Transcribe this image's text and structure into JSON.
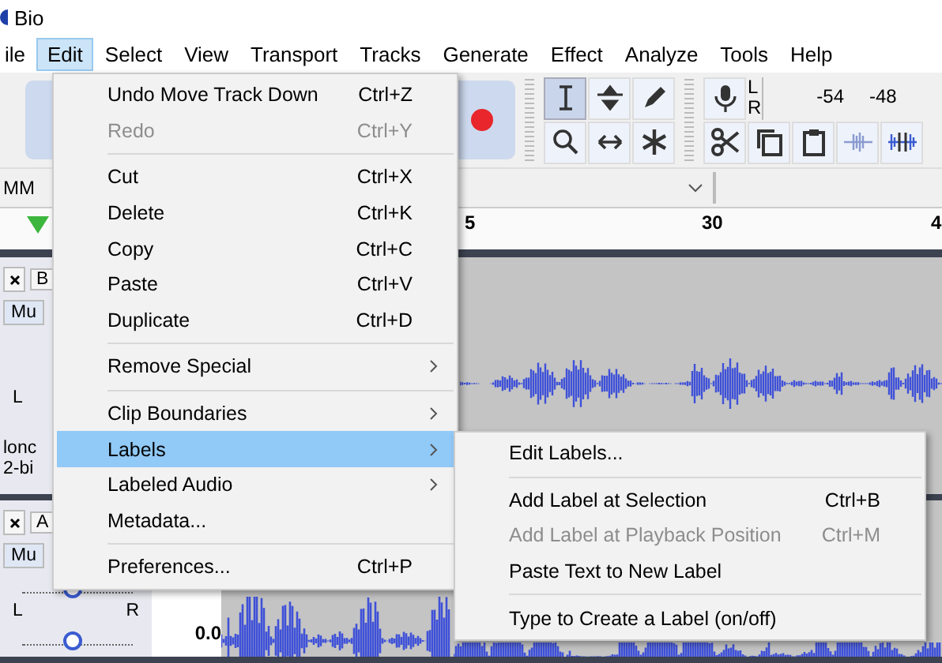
{
  "window": {
    "title": "Bio"
  },
  "menu_bar": [
    {
      "label": "ile",
      "selected": false
    },
    {
      "label": "Edit",
      "selected": true
    },
    {
      "label": "Select",
      "selected": false
    },
    {
      "label": "View",
      "selected": false
    },
    {
      "label": "Transport",
      "selected": false
    },
    {
      "label": "Tracks",
      "selected": false
    },
    {
      "label": "Generate",
      "selected": false
    },
    {
      "label": "Effect",
      "selected": false
    },
    {
      "label": "Analyze",
      "selected": false
    },
    {
      "label": "Tools",
      "selected": false
    },
    {
      "label": "Help",
      "selected": false
    }
  ],
  "tools": [
    {
      "kind": "ibeam",
      "selected": true
    },
    {
      "kind": "envelope",
      "selected": false
    },
    {
      "kind": "draw",
      "selected": false
    },
    {
      "kind": "zoom",
      "selected": false
    },
    {
      "kind": "timeshift",
      "selected": false
    },
    {
      "kind": "multi",
      "selected": false
    }
  ],
  "meter": {
    "channels": [
      "L",
      "R"
    ],
    "ticks": [
      "-54",
      "-48"
    ]
  },
  "device_bar": {
    "device": "MM"
  },
  "ruler": {
    "ticks": [
      "5",
      "30",
      "4"
    ]
  },
  "tracks": [
    {
      "name": "B",
      "mute": "Mu",
      "pan_labels": [
        "L"
      ],
      "info": [
        "lonc",
        "2-bi"
      ]
    },
    {
      "name": "A",
      "mute": "Mu",
      "gain": {
        "level": 0.45
      },
      "pan": {
        "level": 0.45
      },
      "pan_labels": [
        "L",
        "R"
      ],
      "scale": "0.0"
    }
  ],
  "edit_menu": {
    "items": [
      {
        "kind": "item",
        "label": "Undo Move Track Down",
        "shortcut": "Ctrl+Z",
        "disabled": false,
        "submenu": false,
        "selected": false
      },
      {
        "kind": "item",
        "label": "Redo",
        "shortcut": "Ctrl+Y",
        "disabled": true,
        "submenu": false,
        "selected": false
      },
      {
        "kind": "separator"
      },
      {
        "kind": "item",
        "label": "Cut",
        "shortcut": "Ctrl+X",
        "disabled": false,
        "submenu": false,
        "selected": false
      },
      {
        "kind": "item",
        "label": "Delete",
        "shortcut": "Ctrl+K",
        "disabled": false,
        "submenu": false,
        "selected": false
      },
      {
        "kind": "item",
        "label": "Copy",
        "shortcut": "Ctrl+C",
        "disabled": false,
        "submenu": false,
        "selected": false
      },
      {
        "kind": "item",
        "label": "Paste",
        "shortcut": "Ctrl+V",
        "disabled": false,
        "submenu": false,
        "selected": false
      },
      {
        "kind": "item",
        "label": "Duplicate",
        "shortcut": "Ctrl+D",
        "disabled": false,
        "submenu": false,
        "selected": false
      },
      {
        "kind": "separator"
      },
      {
        "kind": "item",
        "label": "Remove Special",
        "disabled": false,
        "submenu": true,
        "selected": false
      },
      {
        "kind": "separator"
      },
      {
        "kind": "item",
        "label": "Clip Boundaries",
        "disabled": false,
        "submenu": true,
        "selected": false
      },
      {
        "kind": "item",
        "label": "Labels",
        "disabled": false,
        "submenu": true,
        "selected": true
      },
      {
        "kind": "item",
        "label": "Labeled Audio",
        "disabled": false,
        "submenu": true,
        "selected": false
      },
      {
        "kind": "item",
        "label": "Metadata...",
        "disabled": false,
        "submenu": false,
        "selected": false
      },
      {
        "kind": "separator"
      },
      {
        "kind": "item",
        "label": "Preferences...",
        "shortcut": "Ctrl+P",
        "disabled": false,
        "submenu": false,
        "selected": false
      }
    ]
  },
  "labels_submenu": {
    "items": [
      {
        "kind": "item",
        "label": "Edit Labels...",
        "disabled": false,
        "submenu": false,
        "selected": false
      },
      {
        "kind": "separator"
      },
      {
        "kind": "item",
        "label": "Add Label at Selection",
        "shortcut": "Ctrl+B",
        "disabled": false,
        "submenu": false,
        "selected": false
      },
      {
        "kind": "item",
        "label": "Add Label at Playback Position",
        "shortcut": "Ctrl+M",
        "disabled": true,
        "submenu": false,
        "selected": false
      },
      {
        "kind": "item",
        "label": "Paste Text to New Label",
        "disabled": false,
        "submenu": false,
        "selected": false
      },
      {
        "kind": "separator"
      },
      {
        "kind": "item",
        "label": "Type to Create a Label (on/off)",
        "disabled": false,
        "submenu": false,
        "selected": false
      }
    ]
  }
}
